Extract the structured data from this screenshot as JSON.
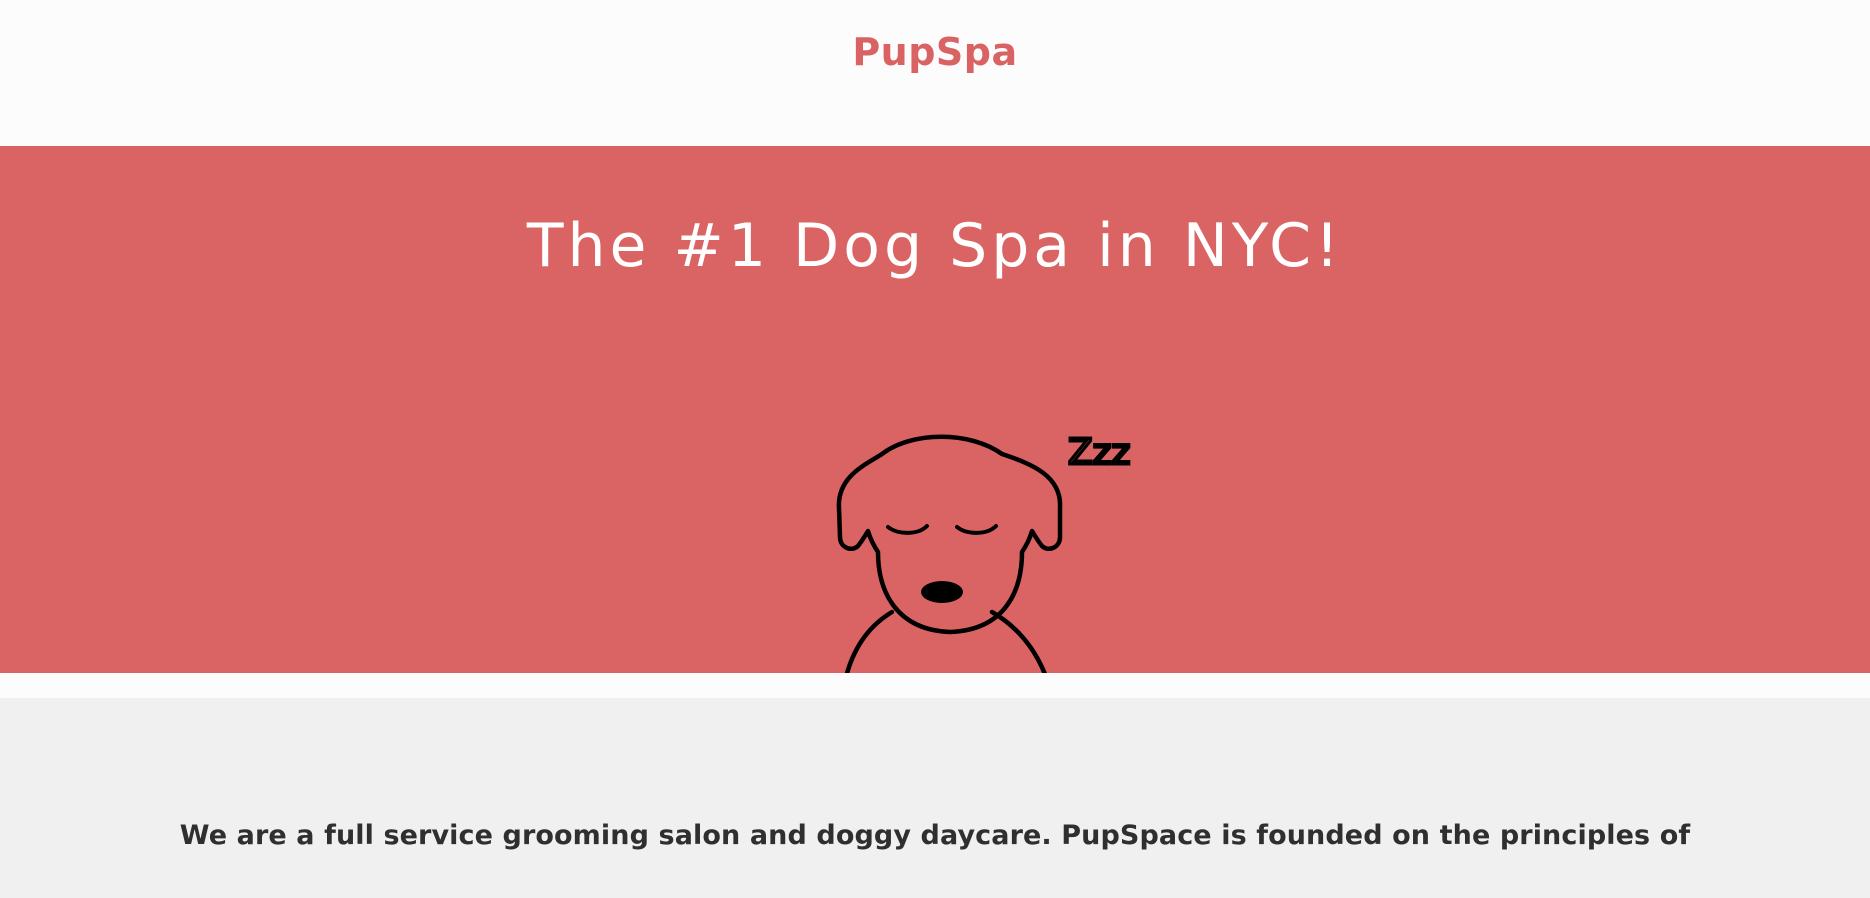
{
  "header": {
    "logo": "PupSpa"
  },
  "hero": {
    "title": "The #1 Dog Spa in NYC!",
    "background_color": "#da6464",
    "illustration": "sleeping-dog-icon",
    "illustration_text": "Zzz"
  },
  "about": {
    "text": "We are a full service grooming salon and doggy daycare. PupSpace is founded on the principles of"
  },
  "colors": {
    "brand": "#d96363",
    "hero_bg": "#da6464",
    "about_bg": "#f0f0f0",
    "text": "#2f2f2f"
  }
}
